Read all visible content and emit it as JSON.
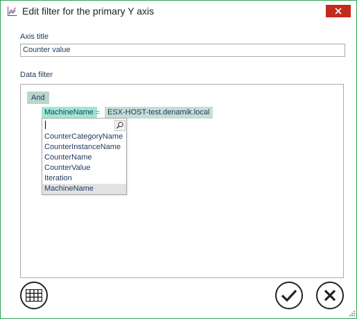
{
  "window": {
    "title": "Edit filter for the primary Y axis",
    "accent_color": "#2ea44f",
    "close_icon": "close-icon"
  },
  "axis_title": {
    "label": "Axis title",
    "value": "Counter value"
  },
  "data_filter": {
    "label": "Data filter",
    "group_operator": "And",
    "condition": {
      "field": "MachineName",
      "operator": "=",
      "value": "ESX-HOST-test.denamik.local"
    },
    "field_dropdown": {
      "search_value": "",
      "items": [
        {
          "label": "CounterCategoryName",
          "selected": false
        },
        {
          "label": "CounterInstanceName",
          "selected": false
        },
        {
          "label": "CounterName",
          "selected": false
        },
        {
          "label": "CounterValue",
          "selected": false
        },
        {
          "label": "Iteration",
          "selected": false
        },
        {
          "label": "MachineName",
          "selected": true
        }
      ]
    }
  },
  "buttons": {
    "table_icon": "table-grid-icon",
    "ok_icon": "checkmark-icon",
    "cancel_icon": "x-icon"
  }
}
